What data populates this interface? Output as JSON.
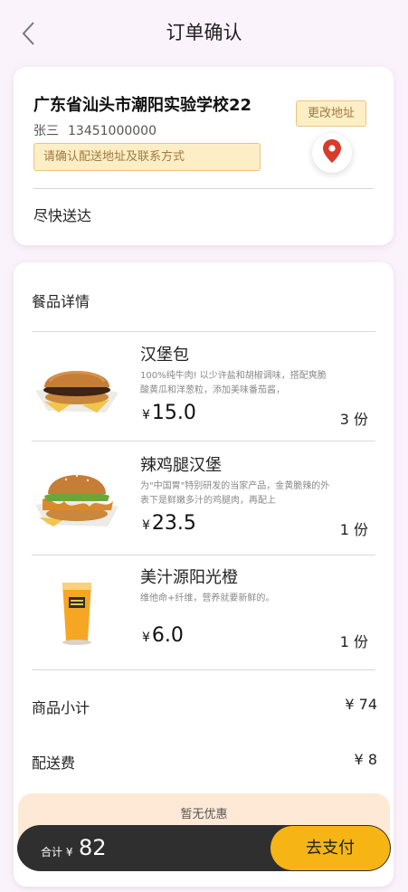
{
  "header": {
    "title": "订单确认",
    "back_icon": "chevron-left-icon"
  },
  "address": {
    "line": "广东省汕头市潮阳实验学校22",
    "name": "张三",
    "phone": "13451000000",
    "tip": "请确认配送地址及联系方式",
    "change_label": "更改地址",
    "location_icon": "map-pin-icon",
    "delivery": "尽快送达"
  },
  "food": {
    "section_title": "餐品详情",
    "items": [
      {
        "name": "汉堡包",
        "desc": "100%纯牛肉! 以少许盐和胡椒调味，搭配爽脆酸黄瓜和洋葱粒，添加美味番茄酱，",
        "currency": "¥",
        "price": "15.0",
        "qty": "3 份"
      },
      {
        "name": "辣鸡腿汉堡",
        "desc": "为\"中国胃\"特别研发的当家产品，金黄脆辣的外表下是鲜嫩多汁的鸡腿肉，再配上",
        "currency": "¥",
        "price": "23.5",
        "qty": "1 份"
      },
      {
        "name": "美汁源阳光橙",
        "desc": "维他命+纤维，营养就要新鲜的。",
        "currency": "¥",
        "price": "6.0",
        "qty": "1 份"
      }
    ]
  },
  "summary": {
    "subtotal_label": "商品小计",
    "subtotal_value": "¥ 74",
    "delivery_label": "配送费",
    "delivery_value": "¥ 8"
  },
  "promo": {
    "text": "暂无优惠"
  },
  "paybar": {
    "total_label": "合计 ¥",
    "total_value": "82",
    "pay_label": "去支付"
  },
  "colors": {
    "accent": "#f7b515",
    "tip_bg": "#fdeec6",
    "pin": "#d93a2b",
    "bar": "#2f2f2f"
  }
}
